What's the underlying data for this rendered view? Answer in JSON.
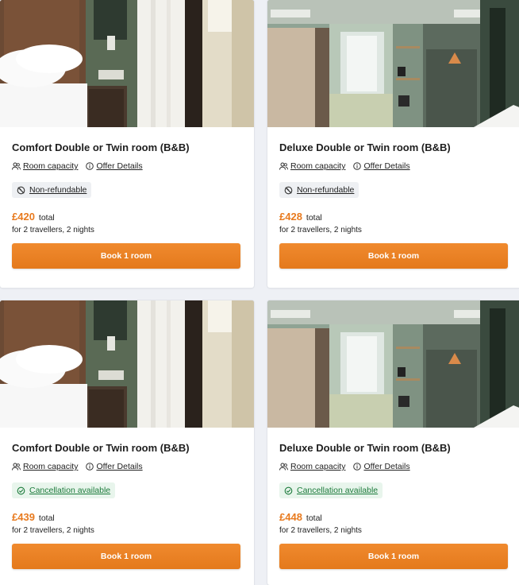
{
  "offers": [
    {
      "title": "Comfort Double or Twin room (B&B)",
      "room_capacity": "Room capacity",
      "offer_details": "Offer Details",
      "policy": "Non-refundable",
      "price": "£420",
      "price_unit": "total",
      "travellers": "for 2 travellers, 2 nights",
      "book_label": "Book 1 room"
    },
    {
      "title": "Deluxe Double or Twin room (B&B)",
      "room_capacity": "Room capacity",
      "offer_details": "Offer Details",
      "policy": "Non-refundable",
      "price": "£428",
      "price_unit": "total",
      "travellers": "for 2 travellers, 2 nights",
      "book_label": "Book 1 room"
    },
    {
      "title": "Comfort Double or Twin room (B&B)",
      "room_capacity": "Room capacity",
      "offer_details": "Offer Details",
      "policy": "Cancellation available",
      "price": "£439",
      "price_unit": "total",
      "travellers": "for 2 travellers, 2 nights",
      "book_label": "Book 1 room"
    },
    {
      "title": "Deluxe Double or Twin room (B&B)",
      "room_capacity": "Room capacity",
      "offer_details": "Offer Details",
      "policy": "Cancellation available",
      "price": "£448",
      "price_unit": "total",
      "travellers": "for 2 travellers, 2 nights",
      "book_label": "Book 1 room"
    }
  ],
  "colors": {
    "accent": "#e87a1e",
    "cancel_green": "#1b7a3a"
  }
}
